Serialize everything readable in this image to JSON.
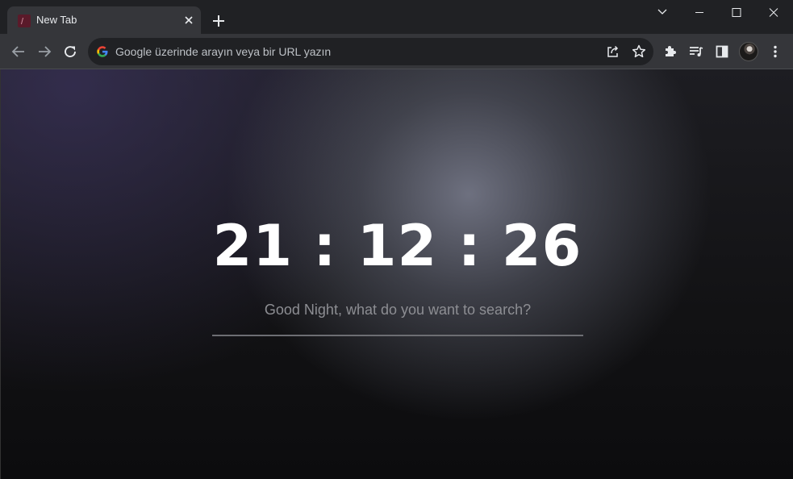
{
  "tab": {
    "title": "New Tab"
  },
  "omnibox": {
    "placeholder": "Google üzerinde arayın veya bir URL yazın"
  },
  "page": {
    "clock": "21 : 12 : 26",
    "search_prompt": "Good Night, what do you want to search?"
  },
  "icons": {
    "tab_close": "close-icon",
    "new_tab": "plus-icon",
    "back": "arrow-left-icon",
    "forward": "arrow-right-icon",
    "reload": "reload-icon",
    "share": "share-icon",
    "bookmark": "star-icon",
    "extensions": "puzzle-icon",
    "media": "media-control-icon",
    "side_panel": "side-panel-icon",
    "menu": "kebab-menu-icon"
  },
  "colors": {
    "frame": "#202124",
    "toolbar": "#35363a",
    "text": "#e8eaed",
    "clock": "#ffffff",
    "prompt": "#8d8e93"
  }
}
